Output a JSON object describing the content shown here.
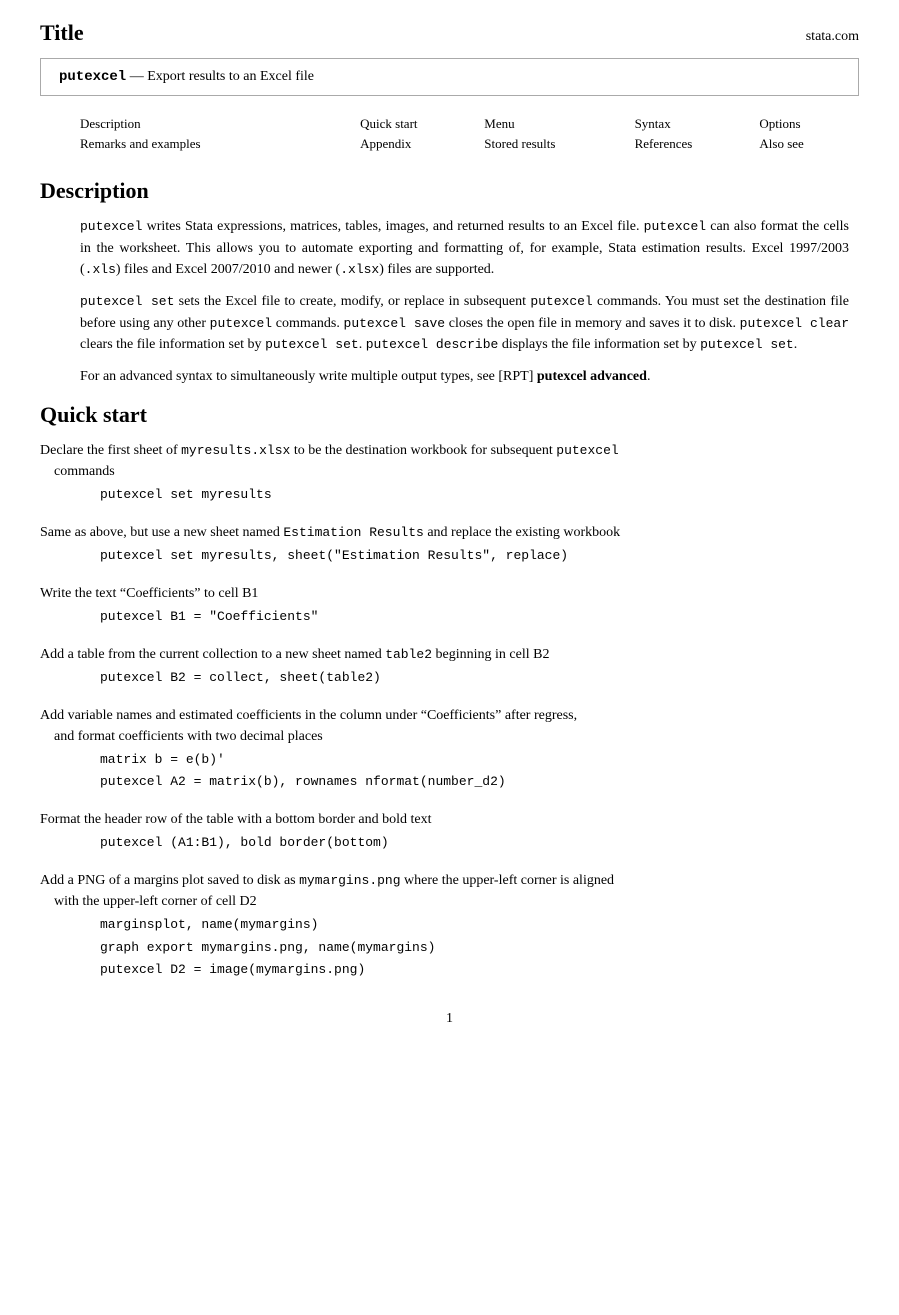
{
  "header": {
    "title": "Title",
    "site": "stata.com"
  },
  "title_box": {
    "command": "putexcel",
    "description": "— Export results to an Excel file"
  },
  "nav": {
    "row1": [
      "Description",
      "Quick start",
      "Menu",
      "Syntax",
      "Options"
    ],
    "row2": [
      "Remarks and examples",
      "Appendix",
      "Stored results",
      "References",
      "Also see"
    ]
  },
  "description": {
    "heading": "Description",
    "paragraphs": [
      "putexcel writes Stata expressions, matrices, tables, images, and returned results to an Excel file. putexcel can also format the cells in the worksheet. This allows you to automate exporting and formatting of, for example, Stata estimation results. Excel 1997/2003 (.xls) files and Excel 2007/2010 and newer (.xlsx) files are supported.",
      "putexcel set sets the Excel file to create, modify, or replace in subsequent putexcel commands. You must set the destination file before using any other putexcel commands. putexcel save closes the open file in memory and saves it to disk. putexcel clear clears the file information set by putexcel set. putexcel describe displays the file information set by putexcel set.",
      "For an advanced syntax to simultaneously write multiple output types, see [RPT] putexcel advanced."
    ]
  },
  "quick_start": {
    "heading": "Quick start",
    "items": [
      {
        "desc": "Declare the first sheet of myresults.xlsx to be the destination workbook for subsequent putexcel commands",
        "code": [
          "putexcel set myresults"
        ]
      },
      {
        "desc": "Same as above, but use a new sheet named Estimation Results and replace the existing workbook",
        "code": [
          "putexcel set myresults, sheet(\"Estimation Results\", replace)"
        ]
      },
      {
        "desc": "Write the text “Coefficients” to cell B1",
        "code": [
          "putexcel B1 = \"Coefficients\""
        ]
      },
      {
        "desc": "Add a table from the current collection to a new sheet named table2 beginning in cell B2",
        "code": [
          "putexcel B2 = collect, sheet(table2)"
        ]
      },
      {
        "desc": "Add variable names and estimated coefficients in the column under “Coefficients” after regress, and format coefficients with two decimal places",
        "code": [
          "matrix b = e(b)'",
          "putexcel A2 = matrix(b), rownames nformat(number_d2)"
        ]
      },
      {
        "desc": "Format the header row of the table with a bottom border and bold text",
        "code": [
          "putexcel (A1:B1), bold border(bottom)"
        ]
      },
      {
        "desc": "Add a PNG of a margins plot saved to disk as mymargins.png where the upper-left corner is aligned with the upper-left corner of cell D2",
        "code": [
          "marginsplot, name(mymargins)",
          "graph export mymargins.png, name(mymargins)",
          "putexcel D2 = image(mymargins.png)"
        ]
      }
    ]
  },
  "footer": {
    "page_number": "1"
  }
}
